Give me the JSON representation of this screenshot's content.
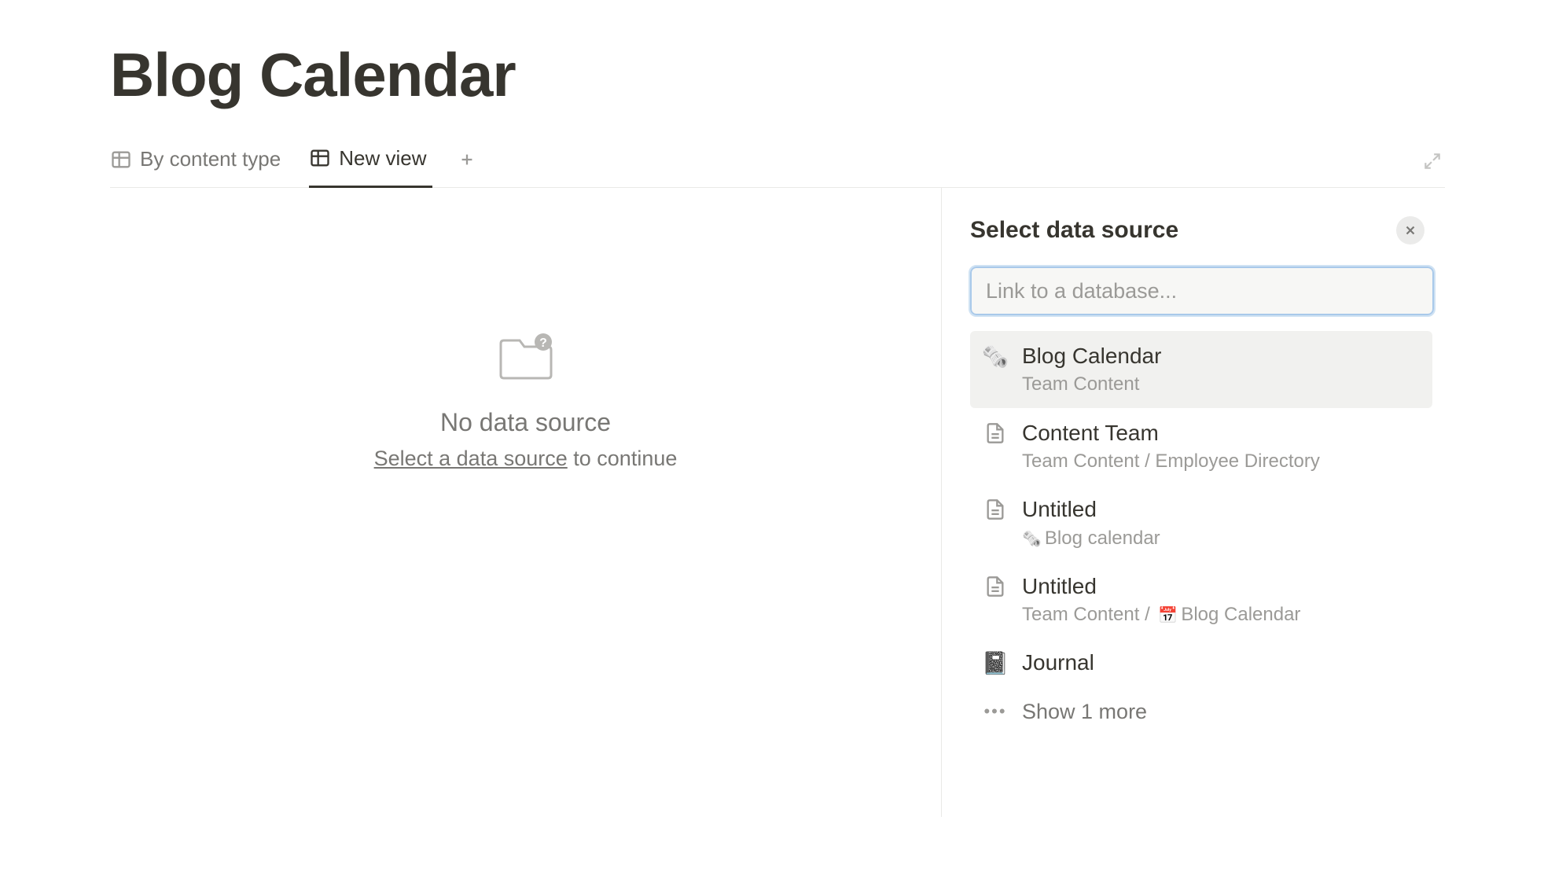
{
  "page": {
    "title": "Blog Calendar"
  },
  "tabs": [
    {
      "label": "By content type",
      "active": false
    },
    {
      "label": "New view",
      "active": true
    }
  ],
  "empty_state": {
    "title": "No data source",
    "link_text": "Select a data source",
    "suffix": " to continue"
  },
  "panel": {
    "title": "Select data source",
    "search_placeholder": "Link to a database...",
    "sources": [
      {
        "title": "Blog Calendar",
        "subtitle": "Team Content",
        "icon": "newspaper",
        "selected": true
      },
      {
        "title": "Content Team",
        "subtitle": "Team Content / Employee Directory",
        "icon": "page",
        "selected": false
      },
      {
        "title": "Untitled",
        "subtitle_prefix": "",
        "subtitle": "Blog calendar",
        "subtitle_icon": "newspaper",
        "icon": "page",
        "selected": false
      },
      {
        "title": "Untitled",
        "subtitle_prefix": "Team Content / ",
        "subtitle": "Blog Calendar",
        "subtitle_icon": "calendar",
        "icon": "page",
        "selected": false
      },
      {
        "title": "Journal",
        "subtitle": "",
        "icon": "journal",
        "selected": false
      }
    ],
    "show_more": "Show 1 more"
  }
}
